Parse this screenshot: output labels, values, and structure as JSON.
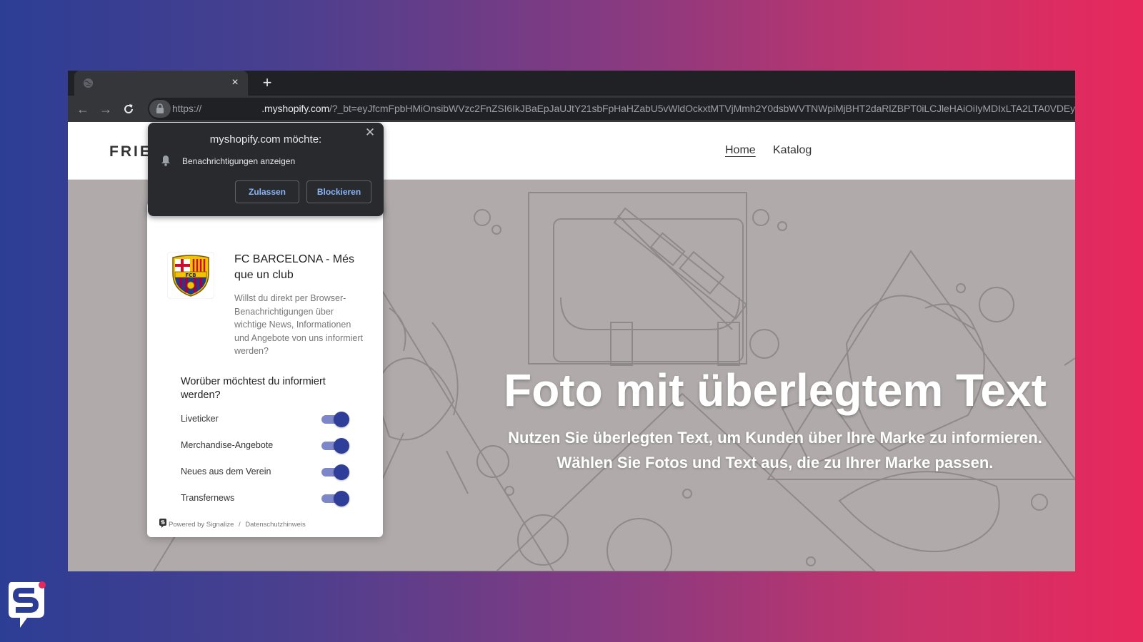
{
  "browser": {
    "tab": {
      "close_glyph": "×",
      "icon": "globe-icon"
    },
    "new_tab_glyph": "+",
    "url_prefix": "https://",
    "url_domain": ".myshopify.com",
    "url_rest": "/?_bt=eyJfcmFpbHMiOnsibWVzc2FnZSI6IkJBaEpJaUJtY21sbFpHaHZabU5vWldOckxtMTVjMmh2Y0dsbWVTNWpiMjBHT2daRlZBPT0iLCJleHAiOiIyMDIxLTA2LTA0VDEy"
  },
  "permission_prompt": {
    "title": "myshopify.com möchte:",
    "item": "Benachrichtigungen anzeigen",
    "allow_label": "Zulassen",
    "block_label": "Blockieren"
  },
  "site": {
    "brand": "FRIE",
    "nav": {
      "home": "Home",
      "catalog": "Katalog"
    },
    "hero_title": "Foto mit überlegtem Text",
    "hero_sub_1": "Nutzen Sie überlegten Text, um Kunden über Ihre Marke zu informieren.",
    "hero_sub_2": "Wählen Sie Fotos und Text aus, die zu Ihrer Marke passen."
  },
  "dialog": {
    "title": "FC BARCELONA - Més que un club",
    "crest_text": "FCB",
    "description": "Willst du direkt per Browser-Benachrichtigungen über wichtige News, Informationen und Angebote von uns informiert werden?",
    "question": "Worüber möchtest du informiert werden?",
    "topics": [
      {
        "label": "Liveticker",
        "enabled": true
      },
      {
        "label": "Merchandise-Angebote",
        "enabled": true
      },
      {
        "label": "Neues aus dem Verein",
        "enabled": true
      },
      {
        "label": "Transfernews",
        "enabled": true
      }
    ],
    "powered_by": "Powered by Signalize",
    "separator": "/",
    "privacy": "Datenschutzhinweis"
  },
  "colors": {
    "toggle_knob": "#2f3f99",
    "toggle_track": "#7d86c8",
    "link_blue": "#8ab4f8",
    "hero_bg": "#b0abaa"
  }
}
